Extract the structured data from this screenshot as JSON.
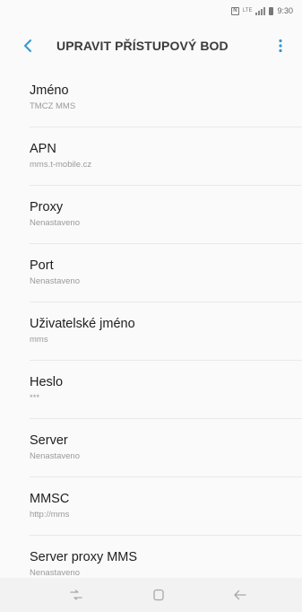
{
  "status_bar": {
    "time": "9:30",
    "network": "LTE"
  },
  "app_bar": {
    "title": "UPRAVIT PŘÍSTUPOVÝ BOD"
  },
  "settings": [
    {
      "label": "Jméno",
      "value": "TMCZ MMS"
    },
    {
      "label": "APN",
      "value": "mms.t-mobile.cz"
    },
    {
      "label": "Proxy",
      "value": "Nenastaveno"
    },
    {
      "label": "Port",
      "value": "Nenastaveno"
    },
    {
      "label": "Uživatelské jméno",
      "value": "mms"
    },
    {
      "label": "Heslo",
      "value": "***"
    },
    {
      "label": "Server",
      "value": "Nenastaveno"
    },
    {
      "label": "MMSC",
      "value": "http://mms"
    },
    {
      "label": "Server proxy MMS",
      "value": "Nenastaveno"
    }
  ],
  "colors": {
    "accent": "#2e9ad6",
    "background": "#fafafa",
    "nav_bar": "#f2f2f2"
  },
  "icons": {
    "back": "chevron-left-icon",
    "more": "more-vertical-icon",
    "recents": "recent-apps-icon",
    "home": "home-icon",
    "back_nav": "back-arrow-icon"
  }
}
